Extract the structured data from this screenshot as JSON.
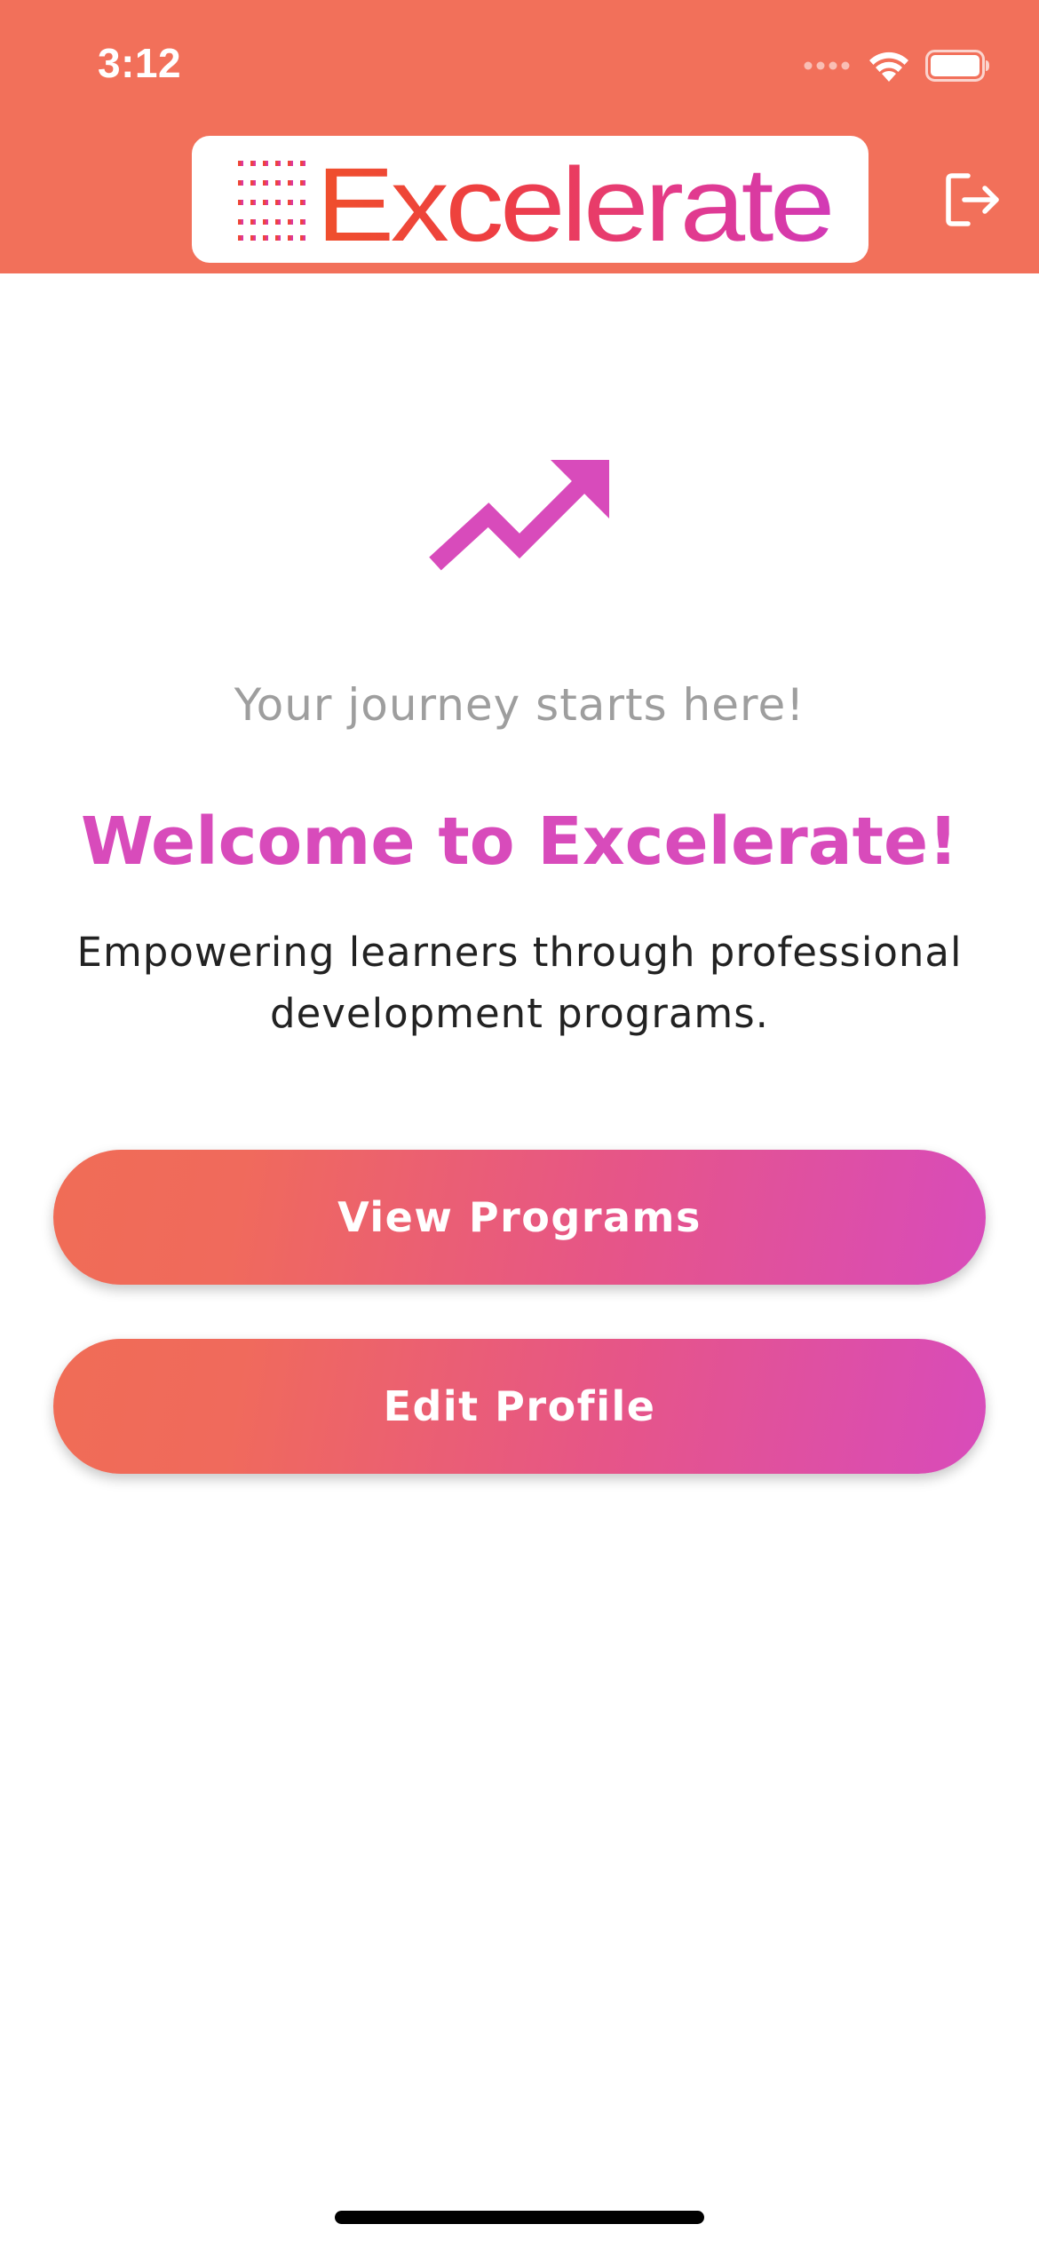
{
  "status_bar": {
    "time": "3:12",
    "icons": [
      "cellular-signal-icon",
      "wifi-icon",
      "battery-icon"
    ]
  },
  "header": {
    "logo_text": "Excelerate",
    "background_color": "#f2705a",
    "logout_icon": "logout-icon"
  },
  "main": {
    "hero_icon": "trending-up-icon",
    "tagline": "Your journey starts here!",
    "title": "Welcome to Excelerate!",
    "description": "Empowering learners through professional development programs.",
    "accent_color": "#d84bbb"
  },
  "actions": {
    "view_programs_label": "View Programs",
    "edit_profile_label": "Edit Profile"
  }
}
